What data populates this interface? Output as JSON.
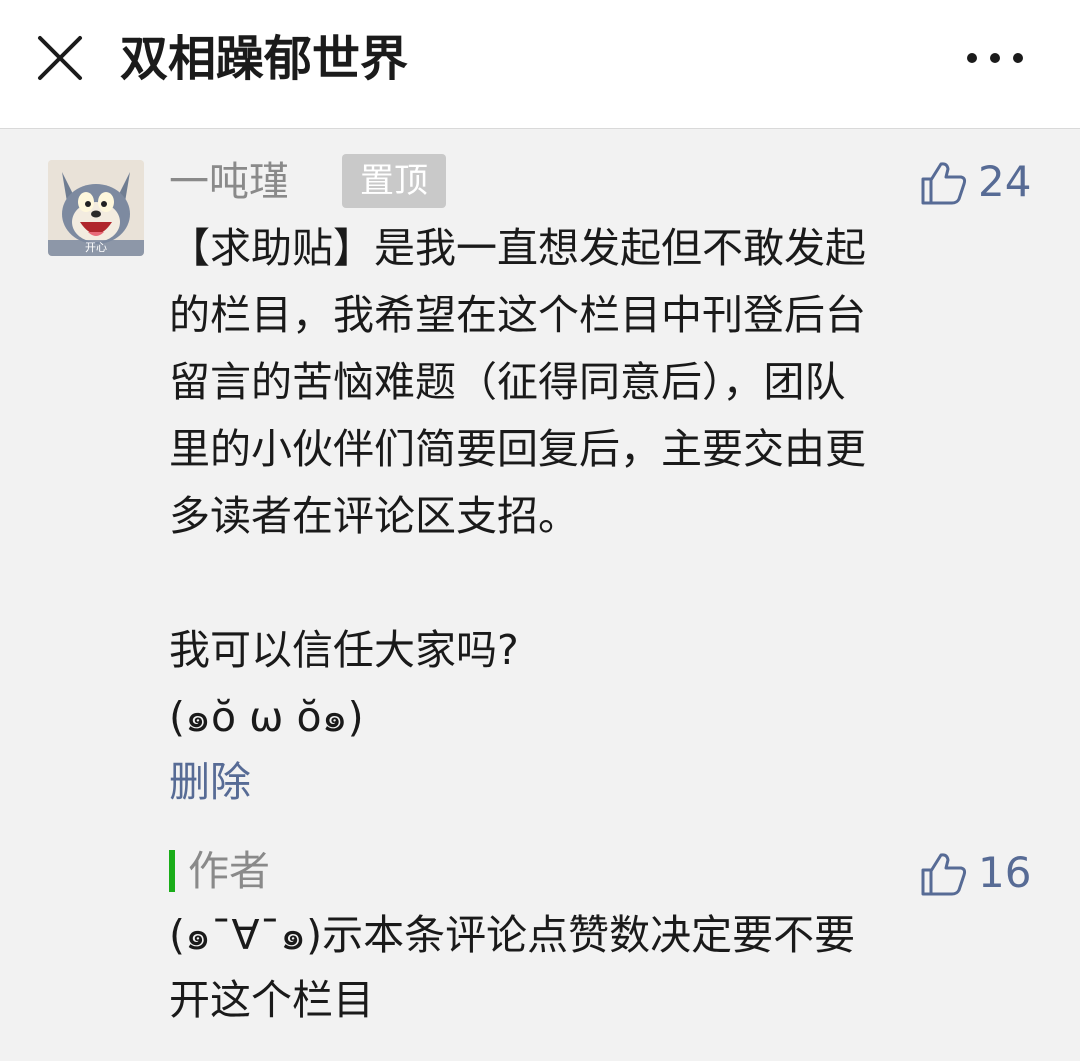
{
  "header": {
    "close_icon": "close-icon",
    "title": "双相躁郁世界",
    "more_icon": "more-dots-icon"
  },
  "comment": {
    "avatar_caption": "开心",
    "username": "一吨瑾",
    "pinned_label": "置顶",
    "likes": "24",
    "paragraph1": [
      "【求助贴】是我一直想发起但不敢发起",
      "的栏目，我希望在这个栏目中刊登后台",
      "留言的苦恼难题（征得同意后），团队",
      "里的小伙伴们简要回复后，主要交由更",
      "多读者在评论区支招。"
    ],
    "paragraph2": [
      "我可以信任大家吗?",
      "(๑ŏ ω ŏ๑)"
    ],
    "delete_label": "删除"
  },
  "author_reply": {
    "label": "作者",
    "likes": "16",
    "text": [
      "(๑¯∀¯๑)示本条评论点赞数决定要不要",
      "开这个栏目"
    ]
  },
  "colors": {
    "link": "#576b95",
    "author_accent": "#1aad19",
    "background": "#f2f2f2"
  }
}
